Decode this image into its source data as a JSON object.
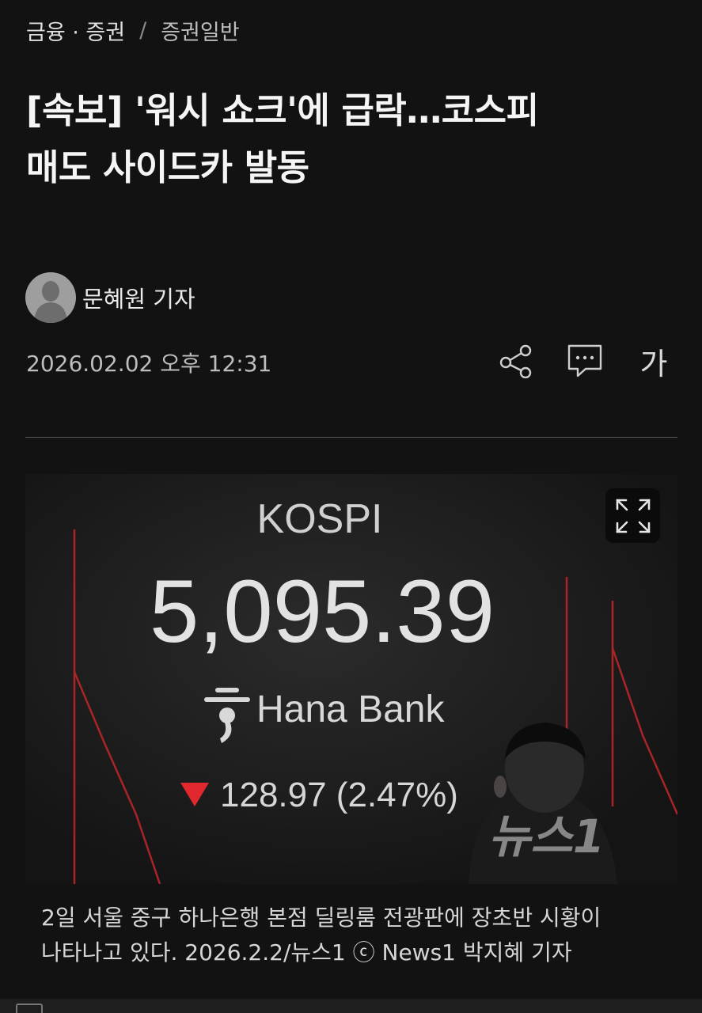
{
  "breadcrumb": {
    "category": "금융 · 증권",
    "separator": "/",
    "subcategory": "증권일반"
  },
  "article": {
    "headline_line1": "[속보] '워시 쇼크'에 급락…코스피",
    "headline_line2": "매도 사이드카 발동",
    "author": "문혜원 기자",
    "date": "2026.02.02 오후 12:31"
  },
  "toolbar": {
    "share_icon": "share-icon",
    "comment_icon": "comment-icon",
    "font_size_label": "가"
  },
  "photo": {
    "board_title": "KOSPI",
    "index_value": "5,095.39",
    "bank": "Hana Bank",
    "change": "128.97 (2.47%)",
    "watermark": "뉴스1",
    "down_color": "#e0282e",
    "expand_icon": "expand-icon"
  },
  "caption": {
    "line1": "2일 서울 중구 하나은행 본점 딜링룸 전광판에 장초반 시황이",
    "line2": "나타나고 있다. 2026.2.2/뉴스1 ⓒ News1 박지혜 기자"
  }
}
